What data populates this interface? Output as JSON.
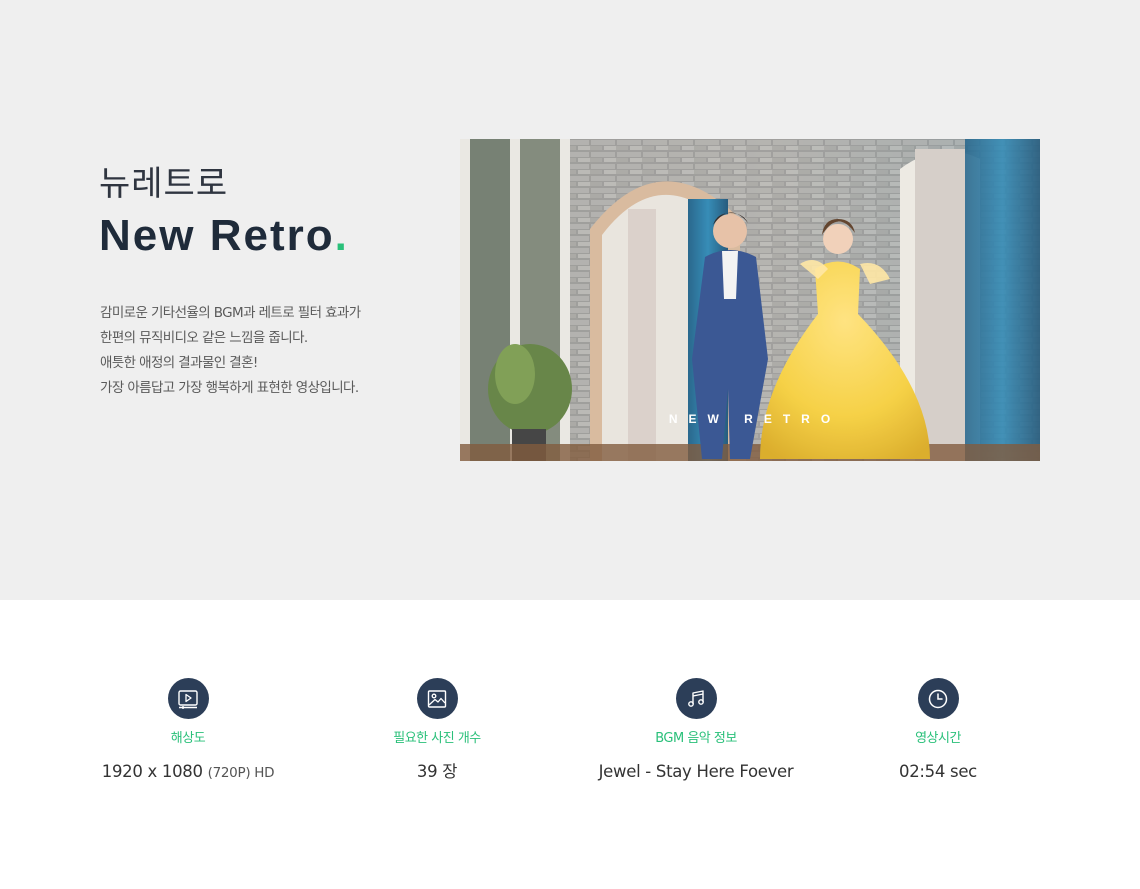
{
  "hero": {
    "title_ko": "뉴레트로",
    "title_en": "New Retro",
    "title_dot": ".",
    "description": [
      "감미로운 기타선율의 BGM과 레트로 필터 효과가",
      "한편의 뮤직비디오 같은 느낌을 줍니다.",
      "애틋한 애정의 결과물인 결혼!",
      "가장 아름답고 가장 행복하게 표현한 영상입니다."
    ],
    "image_caption": "NEW RETRO"
  },
  "specs": [
    {
      "icon": "video-player-icon",
      "label": "해상도",
      "value": "1920 x 1080",
      "value_sub": "(720P) HD"
    },
    {
      "icon": "image-icon",
      "label": "필요한 사진 개수",
      "value": "39 장",
      "value_sub": ""
    },
    {
      "icon": "music-note-icon",
      "label": "BGM 음악 정보",
      "value": "Jewel - Stay Here Foever",
      "value_sub": ""
    },
    {
      "icon": "clock-icon",
      "label": "영상시간",
      "value": "02:54 sec",
      "value_sub": ""
    }
  ],
  "colors": {
    "accent": "#2ac07a",
    "icon_bg": "#2c3e58",
    "hero_bg": "#efefef",
    "title": "#1f2b3a"
  }
}
